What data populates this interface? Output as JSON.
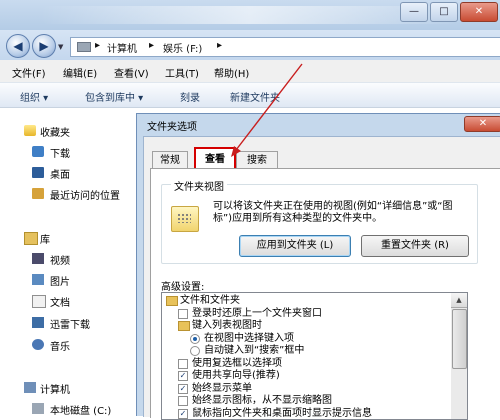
{
  "window": {
    "controls": {
      "minimize": "—",
      "maximize": "□",
      "close": "✕"
    }
  },
  "address": {
    "back": "◀",
    "forward": "▶",
    "sep1": "▸",
    "computer": "计算机",
    "sep2": "▸",
    "drive": "娱乐 (F:)",
    "sep3": "▸"
  },
  "menubar": [
    "文件(F)",
    "编辑(E)",
    "查看(V)",
    "工具(T)",
    "帮助(H)"
  ],
  "commandbar": {
    "organize": "组织 ▾",
    "include": "包含到库中 ▾",
    "burn": "刻录",
    "new_folder": "新建文件夹"
  },
  "sidebar": {
    "favorites": "收藏夹",
    "downloads": "下载",
    "desktop": "桌面",
    "recent": "最近访问的位置",
    "libraries": "库",
    "videos": "视频",
    "pictures": "图片",
    "documents": "文档",
    "xunlei": "迅雷下载",
    "music": "音乐",
    "computer": "计算机",
    "local_disk": "本地磁盘 (C:)"
  },
  "dialog": {
    "title": "文件夹选项",
    "close": "✕",
    "tabs": [
      "常规",
      "查看",
      "搜索"
    ],
    "folder_views": {
      "legend": "文件夹视图",
      "description": "可以将该文件夹正在使用的视图(例如“详细信息”或“图标”)应用到所有这种类型的文件夹中。",
      "apply_button": "应用到文件夹 (L)",
      "reset_button": "重置文件夹 (R)"
    },
    "advanced_label": "高级设置:",
    "advanced_items": [
      {
        "text": "文件和文件夹",
        "kind": "folder",
        "indent": 0
      },
      {
        "text": "登录时还原上一个文件夹窗口",
        "kind": "checkbox",
        "checked": false,
        "indent": 1
      },
      {
        "text": "键入列表视图时",
        "kind": "folder",
        "indent": 1
      },
      {
        "text": "在视图中选择键入项",
        "kind": "radio",
        "checked": true,
        "indent": 2
      },
      {
        "text": "自动键入到“搜索”框中",
        "kind": "radio",
        "checked": false,
        "indent": 2
      },
      {
        "text": "使用复选框以选择项",
        "kind": "checkbox",
        "checked": false,
        "indent": 1
      },
      {
        "text": "使用共享向导(推荐)",
        "kind": "checkbox",
        "checked": true,
        "indent": 1
      },
      {
        "text": "始终显示菜单",
        "kind": "checkbox",
        "checked": true,
        "indent": 1
      },
      {
        "text": "始终显示图标，从不显示缩略图",
        "kind": "checkbox",
        "checked": false,
        "indent": 1
      },
      {
        "text": "鼠标指向文件夹和桌面项时显示提示信息",
        "kind": "checkbox",
        "checked": true,
        "indent": 1
      }
    ],
    "scroll_up": "▲",
    "check_mark": "✓"
  }
}
